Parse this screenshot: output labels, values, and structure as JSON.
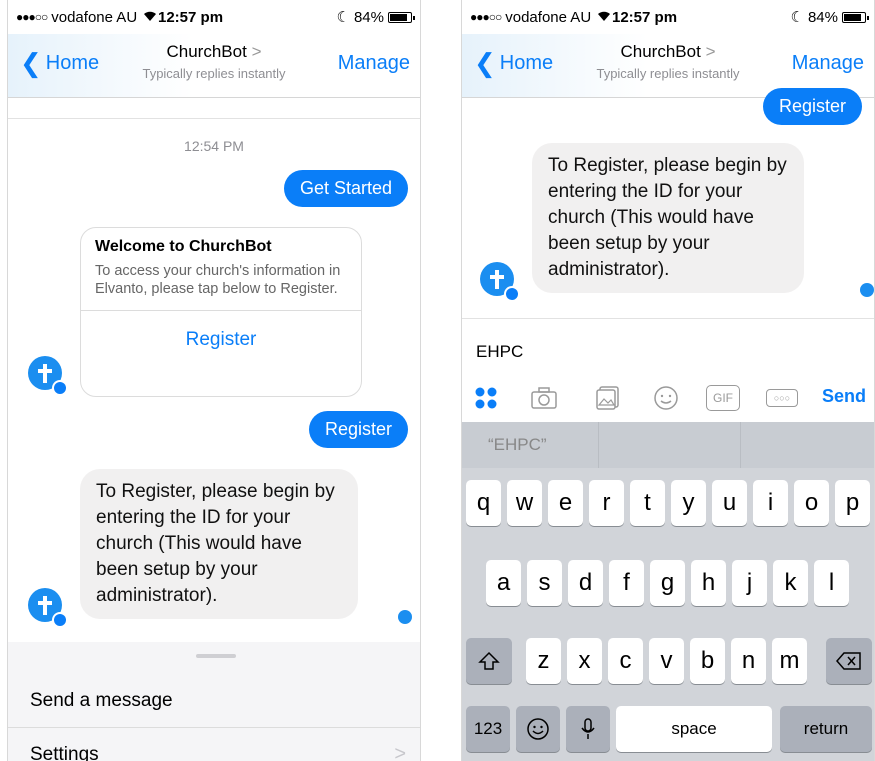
{
  "status": {
    "carrier": "vodafone AU",
    "time": "12:57 pm",
    "battery": "84%"
  },
  "nav": {
    "back_label": "Home",
    "title": "ChurchBot",
    "subtitle": "Typically replies instantly",
    "manage_label": "Manage"
  },
  "left": {
    "timestamp": "12:54 PM",
    "get_started": "Get Started",
    "card": {
      "title": "Welcome to ChurchBot",
      "text": "To access your church's information in Elvanto, please tap below to Register.",
      "button": "Register"
    },
    "register_reply": "Register",
    "bot_message": "To Register, please begin by entering the ID for your church (This would have been setup by your administrator).",
    "menu": {
      "send_message": "Send a message",
      "settings": "Settings"
    }
  },
  "right": {
    "register_reply": "Register",
    "bot_message": "To Register, please begin by entering the ID for your church (This would have been setup by your administrator).",
    "composer_text": "EHPC",
    "gif_label": "GIF",
    "send_label": "Send",
    "suggestion": "“EHPC”"
  },
  "keyboard": {
    "row1": [
      "q",
      "w",
      "e",
      "r",
      "t",
      "y",
      "u",
      "i",
      "o",
      "p"
    ],
    "row2": [
      "a",
      "s",
      "d",
      "f",
      "g",
      "h",
      "j",
      "k",
      "l"
    ],
    "row3": [
      "z",
      "x",
      "c",
      "v",
      "b",
      "n",
      "m"
    ],
    "numbers_label": "123",
    "space_label": "space",
    "return_label": "return"
  },
  "colors": {
    "accent": "#0a7ef8",
    "bubble_in": "#f1f0f0",
    "keyboard_bg": "#d1d4d9"
  }
}
